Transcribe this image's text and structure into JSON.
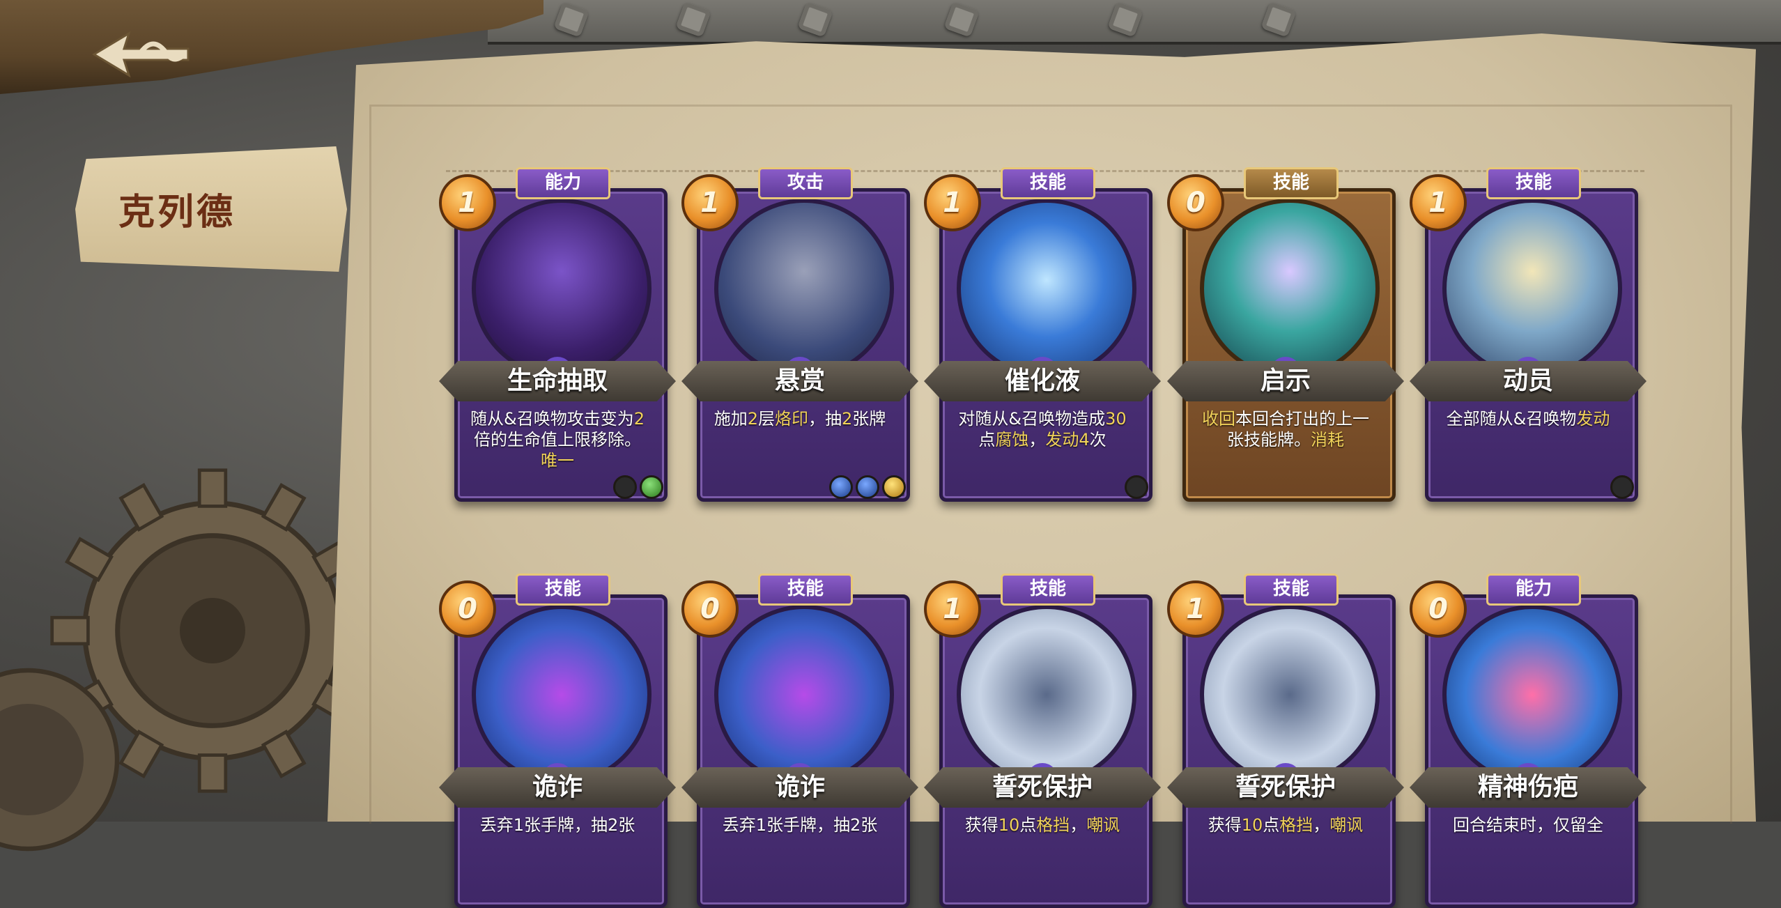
{
  "character": {
    "name": "克列德"
  },
  "colors": {
    "highlight": "#f2d35a",
    "card_purple": "#5a3b8a",
    "card_gold": "#9a6a3a"
  },
  "cards": [
    {
      "cost": "1",
      "type": "能力",
      "name": "生命抽取",
      "frame": "purple",
      "desc": [
        {
          "t": "随从&召唤物攻击变为"
        },
        {
          "t": "2",
          "h": true
        },
        {
          "t": "倍的生命值上限移除。"
        },
        {
          "t": "唯一",
          "h": true
        }
      ],
      "gems": [
        "dark",
        "green"
      ]
    },
    {
      "cost": "1",
      "type": "攻击",
      "name": "悬赏",
      "frame": "purple",
      "desc": [
        {
          "t": "施加"
        },
        {
          "t": "2",
          "h": true
        },
        {
          "t": "层"
        },
        {
          "t": "烙印",
          "h": true
        },
        {
          "t": "，抽"
        },
        {
          "t": "2",
          "h": true
        },
        {
          "t": "张牌"
        }
      ],
      "gems": [
        "blue",
        "blue",
        "yellow"
      ]
    },
    {
      "cost": "1",
      "type": "技能",
      "name": "催化液",
      "frame": "purple",
      "desc": [
        {
          "t": "对随从&召唤物造成"
        },
        {
          "t": "30",
          "h": true
        },
        {
          "t": "点"
        },
        {
          "t": "腐蚀",
          "h": true
        },
        {
          "t": "，"
        },
        {
          "t": "发动",
          "h": true
        },
        {
          "t": "4",
          "h": true
        },
        {
          "t": "次"
        }
      ],
      "gems": [
        "dark"
      ]
    },
    {
      "cost": "0",
      "type": "技能",
      "name": "启示",
      "frame": "gold",
      "desc": [
        {
          "t": "收回",
          "h": true
        },
        {
          "t": "本回合打出的上一张技能牌。"
        },
        {
          "t": "消耗",
          "h": true
        }
      ],
      "gems": []
    },
    {
      "cost": "1",
      "type": "技能",
      "name": "动员",
      "frame": "purple",
      "desc": [
        {
          "t": "全部随从&召唤物"
        },
        {
          "t": "发动",
          "h": true
        }
      ],
      "gems": [
        "dark"
      ]
    },
    {
      "cost": "0",
      "type": "技能",
      "name": "诡诈",
      "frame": "purple",
      "desc": [
        {
          "t": "丢弃1张手牌，抽2张"
        }
      ],
      "gems": []
    },
    {
      "cost": "0",
      "type": "技能",
      "name": "诡诈",
      "frame": "purple",
      "desc": [
        {
          "t": "丢弃1张手牌，抽2张"
        }
      ],
      "gems": []
    },
    {
      "cost": "1",
      "type": "技能",
      "name": "誓死保护",
      "frame": "purple",
      "desc": [
        {
          "t": "获得"
        },
        {
          "t": "10",
          "h": true
        },
        {
          "t": "点"
        },
        {
          "t": "格挡",
          "h": true
        },
        {
          "t": "，"
        },
        {
          "t": "嘲讽",
          "h": true
        }
      ],
      "gems": []
    },
    {
      "cost": "1",
      "type": "技能",
      "name": "誓死保护",
      "frame": "purple",
      "desc": [
        {
          "t": "获得"
        },
        {
          "t": "10",
          "h": true
        },
        {
          "t": "点"
        },
        {
          "t": "格挡",
          "h": true
        },
        {
          "t": "，"
        },
        {
          "t": "嘲讽",
          "h": true
        }
      ],
      "gems": []
    },
    {
      "cost": "0",
      "type": "能力",
      "name": "精神伤疤",
      "frame": "purple",
      "desc": [
        {
          "t": "回合结束时，仅留全"
        }
      ],
      "gems": []
    }
  ]
}
